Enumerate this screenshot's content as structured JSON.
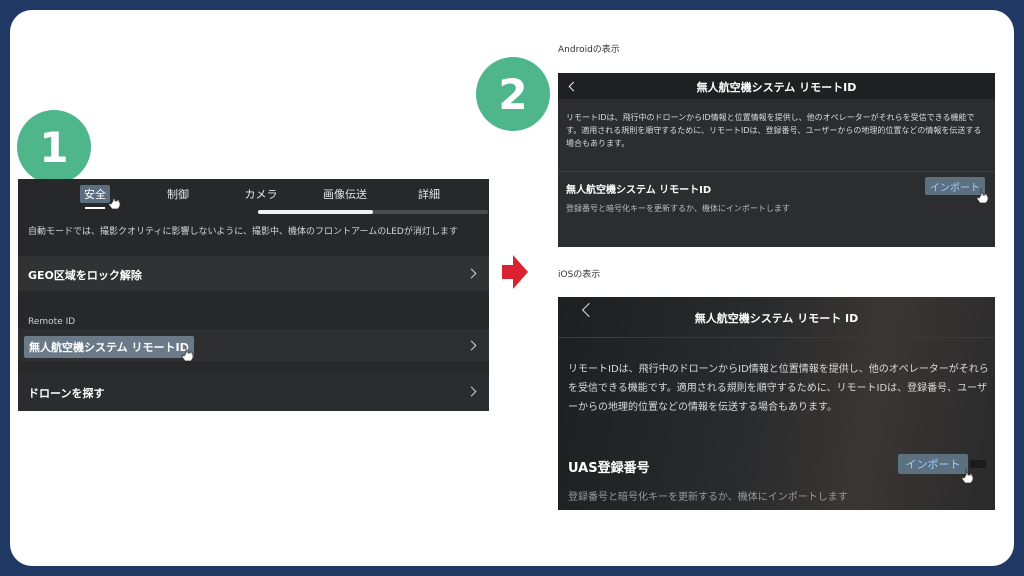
{
  "badges": {
    "step1": "1",
    "step2": "2"
  },
  "left_panel": {
    "tabs": [
      "安全",
      "制御",
      "カメラ",
      "画像伝送",
      "詳細"
    ],
    "active_tab": "安全",
    "scroll_progress": 0.5,
    "note": "自動モードでは、撮影クオリティに影響しないように、撮影中、機体のフロントアームのLEDが消灯します",
    "geo_unlock": "GEO区域をロック解除",
    "section_remote_id": "Remote ID",
    "remote_id_item": "無人航空機システム リモートID",
    "find_drone": "ドローンを探す"
  },
  "android": {
    "caption": "Androidの表示",
    "title": "無人航空機システム リモートID",
    "description": "リモートIDは、飛行中のドローンからID情報と位置情報を提供し、他のオペレーターがそれらを受信できる機能です。適用される規則を順守するために、リモートIDは、登録番号、ユーザーからの地理的位置などの情報を伝送する場合もあります。",
    "section_title": "無人航空機システム リモートID",
    "import_label": "インポート",
    "sub_text": "登録番号と暗号化キーを更新するか、機体にインポートします"
  },
  "ios": {
    "caption": "iOSの表示",
    "title": "無人航空機システム リモート ID",
    "description": "リモートIDは、飛行中のドローンからID情報と位置情報を提供し、他のオペレーターがそれらを受信できる機能です。適用される規則を順守するために、リモートIDは、登録番号、ユーザーからの地理的位置などの情報を伝送する場合もあります。",
    "section_title": "UAS登録番号",
    "import_label": "インポート",
    "sub_text": "登録番号と暗号化キーを更新するか、機体にインポートします"
  },
  "colors": {
    "frame": "#1f3864",
    "badge": "#4fb58a",
    "arrow": "#d9242f",
    "panel": "#26282a",
    "import_text": "#9ed0ff"
  },
  "icons": [
    "hand-cursor-icon",
    "chevron-right-icon",
    "back-arrow-icon",
    "right-arrow-icon"
  ]
}
